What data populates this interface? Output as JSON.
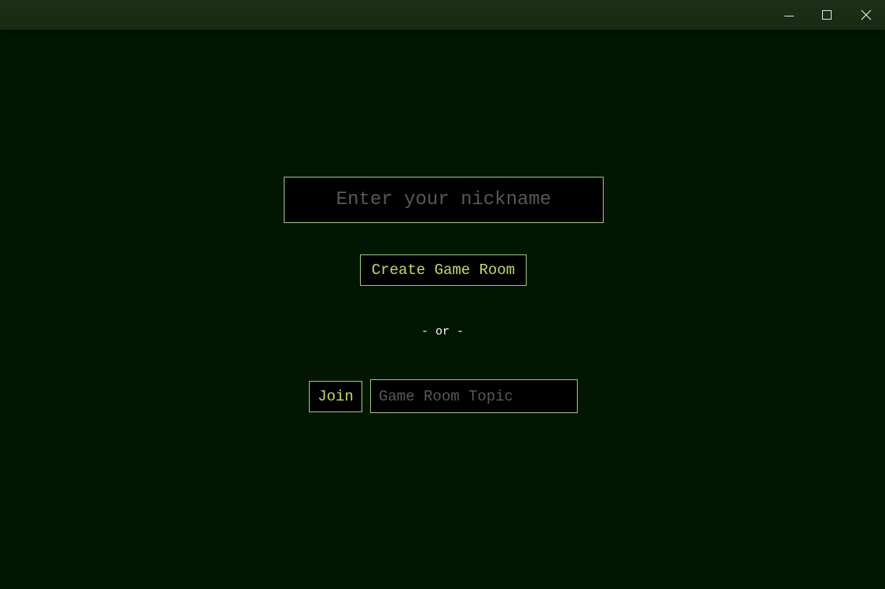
{
  "window": {
    "controls": {
      "minimize_icon": "minimize-icon",
      "maximize_icon": "maximize-icon",
      "close_icon": "close-icon"
    }
  },
  "form": {
    "nickname": {
      "value": "",
      "placeholder": "Enter your nickname"
    },
    "create_label": "Create Game Room",
    "separator": "- or -",
    "join_label": "Join",
    "topic": {
      "value": "",
      "placeholder": "Game Room Topic"
    }
  },
  "colors": {
    "background": "#011701",
    "titlebar": "#1a2f15",
    "accent_border": "#a7c77f",
    "button_text": "#c7d95d",
    "placeholder_text": "#585858",
    "separator_text": "#ffffff",
    "field_background": "#000000"
  }
}
